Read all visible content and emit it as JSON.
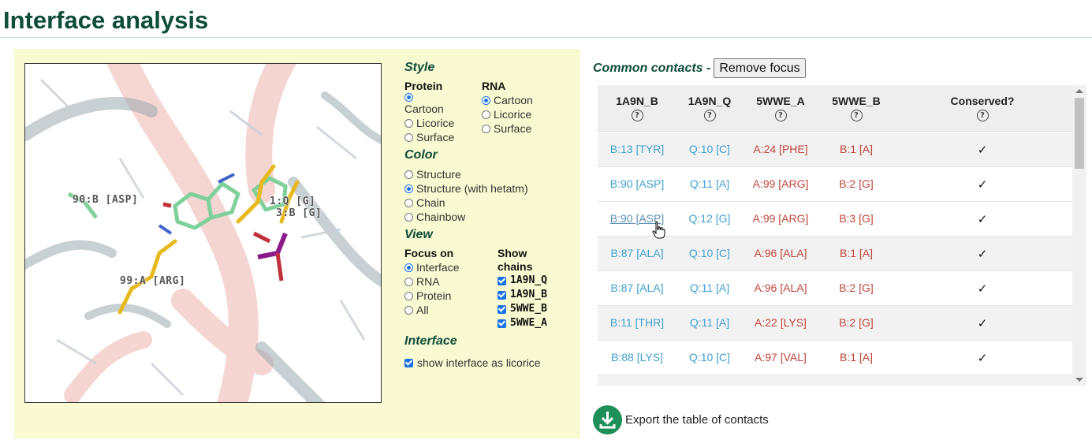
{
  "title": "Interface analysis",
  "viewer": {
    "labels": [
      "90:B [ASP]",
      "1:Q [G]",
      "3:B [G]",
      "99:A [ARG]"
    ]
  },
  "style": {
    "heading": "Style",
    "protein_heading": "Protein",
    "rna_heading": "RNA",
    "protein_options": [
      "Cartoon",
      "Licorice",
      "Surface"
    ],
    "protein_selected": "Cartoon",
    "rna_options": [
      "Cartoon",
      "Licorice",
      "Surface"
    ],
    "rna_selected": "Cartoon"
  },
  "color": {
    "heading": "Color",
    "options": [
      "Structure",
      "Structure (with hetatm)",
      "Chain",
      "Chainbow"
    ],
    "selected": "Structure (with hetatm)"
  },
  "view": {
    "heading": "View",
    "focus_heading": "Focus on",
    "focus_options": [
      "Interface",
      "RNA",
      "Protein",
      "All"
    ],
    "focus_selected": "Interface",
    "chains_heading_1": "Show",
    "chains_heading_2": "chains",
    "chains": [
      "1A9N_Q",
      "1A9N_B",
      "5WWE_B",
      "5WWE_A"
    ]
  },
  "interface": {
    "heading": "Interface",
    "licorice_label": "show interface as licorice",
    "licorice_checked": true
  },
  "contacts": {
    "title": "Common contacts -",
    "remove_focus_label": "Remove focus",
    "columns": [
      "1A9N_B",
      "1A9N_Q",
      "5WWE_A",
      "5WWE_B",
      "Conserved?"
    ],
    "help_glyph": "?",
    "rows": [
      [
        "B:13 [TYR]",
        "Q:10 [C]",
        "A:24 [PHE]",
        "B:1 [A]",
        "✓"
      ],
      [
        "B:90 [ASP]",
        "Q:11 [A]",
        "A:99 [ARG]",
        "B:2 [G]",
        "✓"
      ],
      [
        "B:90 [ASP]",
        "Q:12 [G]",
        "A:99 [ARG]",
        "B:3 [G]",
        "✓"
      ],
      [
        "B:87 [ALA]",
        "Q:10 [C]",
        "A:96 [ALA]",
        "B:1 [A]",
        "✓"
      ],
      [
        "B:87 [ALA]",
        "Q:11 [A]",
        "A:96 [ALA]",
        "B:2 [G]",
        "✓"
      ],
      [
        "B:11 [THR]",
        "Q:11 [A]",
        "A:22 [LYS]",
        "B:2 [G]",
        "✓"
      ],
      [
        "B:88 [LYS]",
        "Q:10 [C]",
        "A:97 [VAL]",
        "B:1 [A]",
        "✓"
      ]
    ]
  },
  "export": {
    "label": "Export the table of contacts"
  },
  "colors": {
    "heading_green": "#0e4d3a",
    "panel_bg": "#fafad2",
    "chain_blue": "#3ea0cf",
    "chain_red": "#c0453a",
    "export_green": "#1f8f5a"
  }
}
